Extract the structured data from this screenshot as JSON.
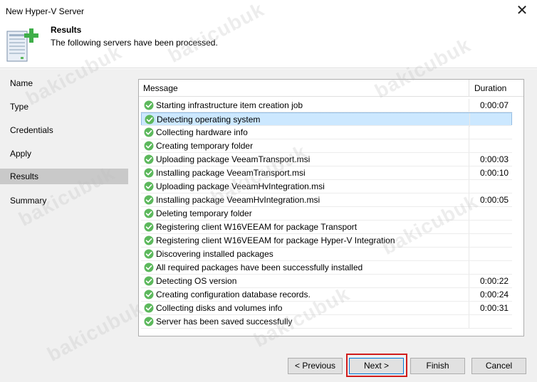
{
  "window": {
    "title": "New Hyper-V Server",
    "close_glyph": "✕"
  },
  "header": {
    "title": "Results",
    "subtitle": "The following servers have been processed."
  },
  "sidebar": {
    "items": [
      "Name",
      "Type",
      "Credentials",
      "Apply",
      "Results",
      "Summary"
    ],
    "active": "Results"
  },
  "table": {
    "columns": {
      "message": "Message",
      "duration": "Duration"
    },
    "rows": [
      {
        "message": "Starting infrastructure item creation job",
        "duration": "0:00:07"
      },
      {
        "message": "Detecting operating system",
        "duration": ""
      },
      {
        "message": "Collecting hardware info",
        "duration": ""
      },
      {
        "message": "Creating temporary folder",
        "duration": ""
      },
      {
        "message": "Uploading package VeeamTransport.msi",
        "duration": "0:00:03"
      },
      {
        "message": "Installing package VeeamTransport.msi",
        "duration": "0:00:10"
      },
      {
        "message": "Uploading package VeeamHvIntegration.msi",
        "duration": ""
      },
      {
        "message": "Installing package VeeamHvIntegration.msi",
        "duration": "0:00:05"
      },
      {
        "message": "Deleting temporary folder",
        "duration": ""
      },
      {
        "message": "Registering client W16VEEAM for package Transport",
        "duration": ""
      },
      {
        "message": "Registering client W16VEEAM for package Hyper-V Integration",
        "duration": ""
      },
      {
        "message": "Discovering installed packages",
        "duration": ""
      },
      {
        "message": "All required packages have been successfully installed",
        "duration": ""
      },
      {
        "message": "Detecting OS version",
        "duration": "0:00:22"
      },
      {
        "message": "Creating configuration database records.",
        "duration": "0:00:24"
      },
      {
        "message": "Collecting disks and volumes info",
        "duration": "0:00:31"
      },
      {
        "message": "Server has been saved successfully",
        "duration": ""
      }
    ],
    "selected_row": 1,
    "status_icon": "success-check-icon"
  },
  "buttons": {
    "previous": "< Previous",
    "next": "Next >",
    "finish": "Finish",
    "cancel": "Cancel"
  },
  "colors": {
    "accent": "#0078d7",
    "success": "#5cb85c",
    "highlight_border": "#d01c1c",
    "selection": "#cce8ff"
  },
  "watermark": "bakicubuk"
}
